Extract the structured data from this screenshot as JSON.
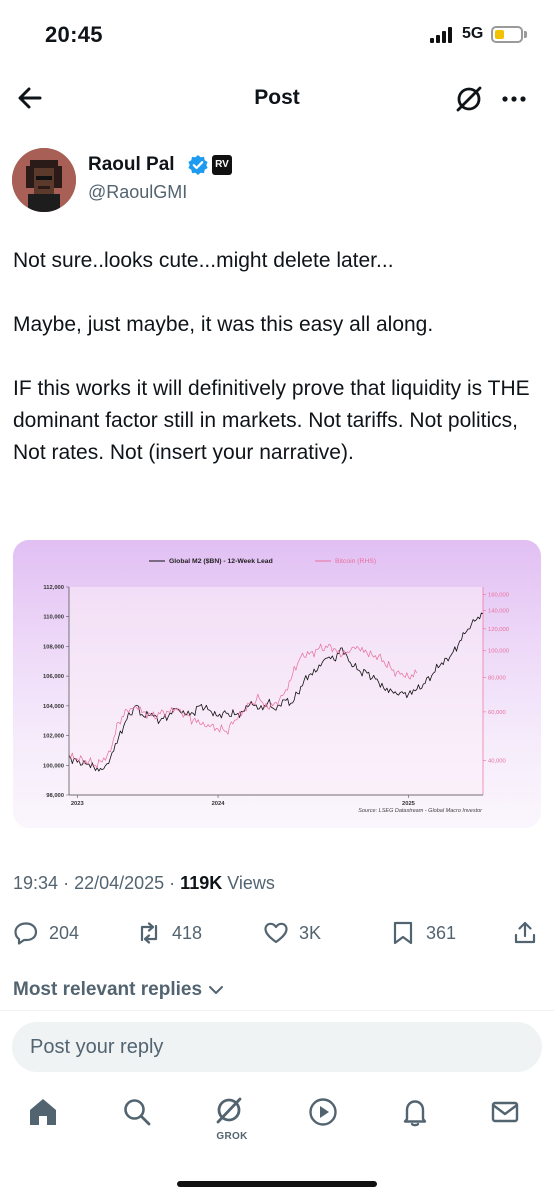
{
  "status": {
    "time": "20:45",
    "network": "5G"
  },
  "nav": {
    "title": "Post",
    "back_icon": "arrow-left-icon",
    "grok_icon": "grok-icon",
    "more_icon": "more-icon"
  },
  "author": {
    "name": "Raoul Pal",
    "handle": "@RaoulGMI",
    "badge_text": "RV",
    "verified": true
  },
  "tweet": {
    "text": "Not sure..looks cute...might delete later...\n\nMaybe, just maybe, it was this easy all along.\n\nIF this works it will definitively prove that liquidity is THE dominant factor still in markets. Not tariffs. Not politics, Not rates. Not (insert your narrative)."
  },
  "chart_data": {
    "type": "line",
    "title": "",
    "legend": [
      "Global M2 ($BN) - 12-Week Lead",
      "Bitcoin (RHS)"
    ],
    "legend_position": "top-center",
    "source": "Source: LSEG Datastream - Global Macro Investor",
    "x_ticks": [
      "2023",
      "2024",
      "2025"
    ],
    "y_left": {
      "ticks": [
        "98,000",
        "100,000",
        "102,000",
        "104,000",
        "106,000",
        "108,000",
        "110,000",
        "112,000"
      ],
      "ylim": [
        98000,
        112000
      ]
    },
    "y_right": {
      "scale": "log",
      "ticks": [
        "40,000",
        "60,000",
        "80,000",
        "100,000",
        "120,000",
        "140,000",
        "160,000"
      ],
      "ylim": [
        30000,
        170000
      ]
    },
    "colors": {
      "m2": "#111111",
      "btc": "#e86f9b"
    },
    "series": [
      {
        "name": "Global M2 ($BN) - 12-Week Lead",
        "axis": "left",
        "x": [
          0.0,
          0.02,
          0.04,
          0.06,
          0.08,
          0.1,
          0.12,
          0.14,
          0.16,
          0.18,
          0.2,
          0.22,
          0.24,
          0.26,
          0.28,
          0.3,
          0.32,
          0.34,
          0.36,
          0.38,
          0.4,
          0.42,
          0.44,
          0.46,
          0.48,
          0.5,
          0.52,
          0.54,
          0.56,
          0.58,
          0.6,
          0.62,
          0.64,
          0.66,
          0.68,
          0.7,
          0.72,
          0.74,
          0.76,
          0.78,
          0.8,
          0.82,
          0.84,
          0.86,
          0.88,
          0.9,
          0.92,
          0.94,
          0.96,
          0.98,
          1.0
        ],
        "values": [
          100600,
          100200,
          100100,
          99900,
          99700,
          100500,
          101900,
          103100,
          104000,
          103300,
          103500,
          103000,
          103300,
          103800,
          103400,
          103500,
          104100,
          103700,
          103300,
          103500,
          103400,
          103600,
          104300,
          103800,
          104200,
          103700,
          104400,
          104200,
          105300,
          106100,
          106400,
          107200,
          107100,
          107900,
          106900,
          106400,
          106200,
          105800,
          105200,
          105000,
          104900,
          104800,
          105100,
          105500,
          106200,
          106900,
          107300,
          108100,
          109000,
          109700,
          110200
        ]
      },
      {
        "name": "Bitcoin (RHS)",
        "axis": "right",
        "x": [
          0.0,
          0.02,
          0.04,
          0.06,
          0.08,
          0.1,
          0.12,
          0.14,
          0.16,
          0.18,
          0.2,
          0.22,
          0.24,
          0.26,
          0.28,
          0.3,
          0.32,
          0.34,
          0.36,
          0.38,
          0.4,
          0.42,
          0.44,
          0.46,
          0.48,
          0.5,
          0.52,
          0.54,
          0.56,
          0.58,
          0.6,
          0.62,
          0.64,
          0.66,
          0.68,
          0.7,
          0.72,
          0.74,
          0.76,
          0.78,
          0.8,
          0.82,
          0.84
        ],
        "values": [
          42000,
          40500,
          40000,
          38500,
          39500,
          43000,
          55000,
          61000,
          63000,
          60000,
          58000,
          59000,
          60000,
          62000,
          59000,
          56000,
          54000,
          53000,
          52000,
          51000,
          56000,
          60000,
          64000,
          67000,
          62000,
          65000,
          70000,
          82000,
          95000,
          97000,
          101000,
          104000,
          102000,
          96000,
          100000,
          102000,
          98000,
          96000,
          92000,
          85000,
          82000,
          80000,
          83000
        ]
      }
    ]
  },
  "meta": {
    "time": "19:34",
    "date": "22/04/2025",
    "views_count": "119K",
    "views_label": "Views"
  },
  "actions": {
    "replies": "204",
    "reposts": "418",
    "likes": "3K",
    "bookmarks": "361"
  },
  "replies": {
    "sort_label": "Most relevant replies"
  },
  "reply_box": {
    "placeholder": "Post your reply"
  },
  "tabbar": {
    "grok_label": "GROK"
  }
}
